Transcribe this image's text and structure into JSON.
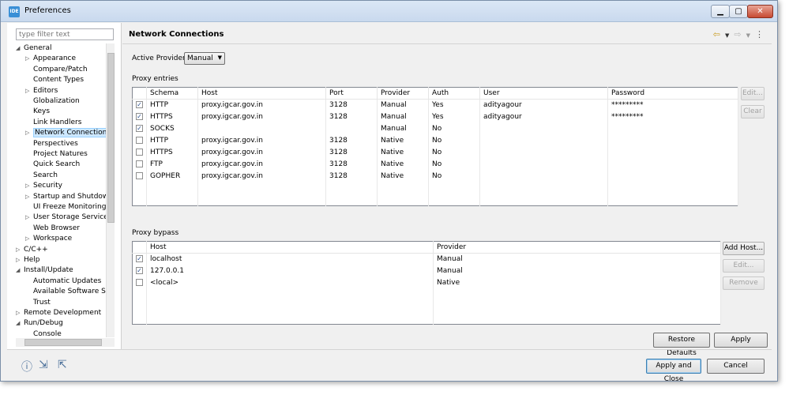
{
  "window": {
    "title": "Preferences",
    "app_icon": "IDE"
  },
  "filter": {
    "placeholder": "type filter text"
  },
  "tree": [
    {
      "label": "General",
      "arrow": "◢",
      "indent": 0
    },
    {
      "label": "Appearance",
      "arrow": "▷",
      "indent": 1
    },
    {
      "label": "Compare/Patch",
      "arrow": "",
      "indent": 1
    },
    {
      "label": "Content Types",
      "arrow": "",
      "indent": 1
    },
    {
      "label": "Editors",
      "arrow": "▷",
      "indent": 1
    },
    {
      "label": "Globalization",
      "arrow": "",
      "indent": 1
    },
    {
      "label": "Keys",
      "arrow": "",
      "indent": 1
    },
    {
      "label": "Link Handlers",
      "arrow": "",
      "indent": 1
    },
    {
      "label": "Network Connections",
      "arrow": "▷",
      "indent": 1,
      "selected": true
    },
    {
      "label": "Perspectives",
      "arrow": "",
      "indent": 1
    },
    {
      "label": "Project Natures",
      "arrow": "",
      "indent": 1
    },
    {
      "label": "Quick Search",
      "arrow": "",
      "indent": 1
    },
    {
      "label": "Search",
      "arrow": "",
      "indent": 1
    },
    {
      "label": "Security",
      "arrow": "▷",
      "indent": 1
    },
    {
      "label": "Startup and Shutdown",
      "arrow": "▷",
      "indent": 1
    },
    {
      "label": "UI Freeze Monitoring",
      "arrow": "",
      "indent": 1
    },
    {
      "label": "User Storage Service",
      "arrow": "▷",
      "indent": 1
    },
    {
      "label": "Web Browser",
      "arrow": "",
      "indent": 1
    },
    {
      "label": "Workspace",
      "arrow": "▷",
      "indent": 1
    },
    {
      "label": "C/C++",
      "arrow": "▷",
      "indent": 0
    },
    {
      "label": "Help",
      "arrow": "▷",
      "indent": 0
    },
    {
      "label": "Install/Update",
      "arrow": "◢",
      "indent": 0
    },
    {
      "label": "Automatic Updates",
      "arrow": "",
      "indent": 1
    },
    {
      "label": "Available Software Sites",
      "arrow": "",
      "indent": 1
    },
    {
      "label": "Trust",
      "arrow": "",
      "indent": 1
    },
    {
      "label": "Remote Development",
      "arrow": "▷",
      "indent": 0
    },
    {
      "label": "Run/Debug",
      "arrow": "◢",
      "indent": 0
    },
    {
      "label": "Console",
      "arrow": "",
      "indent": 1
    }
  ],
  "page": {
    "title": "Network Connections",
    "active_provider_label": "Active Provider:",
    "active_provider_value": "Manual",
    "proxy_entries_label": "Proxy entries",
    "proxy_bypass_label": "Proxy bypass"
  },
  "proxy_entries": {
    "columns": [
      "",
      "Schema",
      "Host",
      "Port",
      "Provider",
      "Auth",
      "User",
      "Password"
    ],
    "rows": [
      {
        "checked": true,
        "schema": "HTTP",
        "host": "proxy.igcar.gov.in",
        "port": "3128",
        "provider": "Manual",
        "auth": "Yes",
        "user": "adityagour",
        "password": "*********"
      },
      {
        "checked": true,
        "schema": "HTTPS",
        "host": "proxy.igcar.gov.in",
        "port": "3128",
        "provider": "Manual",
        "auth": "Yes",
        "user": "adityagour",
        "password": "*********"
      },
      {
        "checked": true,
        "schema": "SOCKS",
        "host": "",
        "port": "",
        "provider": "Manual",
        "auth": "No",
        "user": "",
        "password": ""
      },
      {
        "checked": false,
        "schema": "HTTP",
        "host": "proxy.igcar.gov.in",
        "port": "3128",
        "provider": "Native",
        "auth": "No",
        "user": "",
        "password": ""
      },
      {
        "checked": false,
        "schema": "HTTPS",
        "host": "proxy.igcar.gov.in",
        "port": "3128",
        "provider": "Native",
        "auth": "No",
        "user": "",
        "password": ""
      },
      {
        "checked": false,
        "schema": "FTP",
        "host": "proxy.igcar.gov.in",
        "port": "3128",
        "provider": "Native",
        "auth": "No",
        "user": "",
        "password": ""
      },
      {
        "checked": false,
        "schema": "GOPHER",
        "host": "proxy.igcar.gov.in",
        "port": "3128",
        "provider": "Native",
        "auth": "No",
        "user": "",
        "password": ""
      }
    ],
    "edit_label": "Edit...",
    "clear_label": "Clear"
  },
  "proxy_bypass": {
    "columns": [
      "",
      "Host",
      "Provider"
    ],
    "rows": [
      {
        "checked": true,
        "host": "localhost",
        "provider": "Manual"
      },
      {
        "checked": true,
        "host": "127.0.0.1",
        "provider": "Manual"
      },
      {
        "checked": false,
        "host": "<local>",
        "provider": "Native"
      }
    ],
    "add_host_label": "Add Host...",
    "edit_label": "Edit...",
    "remove_label": "Remove"
  },
  "buttons": {
    "restore_defaults": "Restore Defaults",
    "apply": "Apply",
    "apply_and_close": "Apply and Close",
    "cancel": "Cancel"
  },
  "icons": {
    "help": "help-icon",
    "import": "import-icon",
    "export": "export-icon"
  }
}
